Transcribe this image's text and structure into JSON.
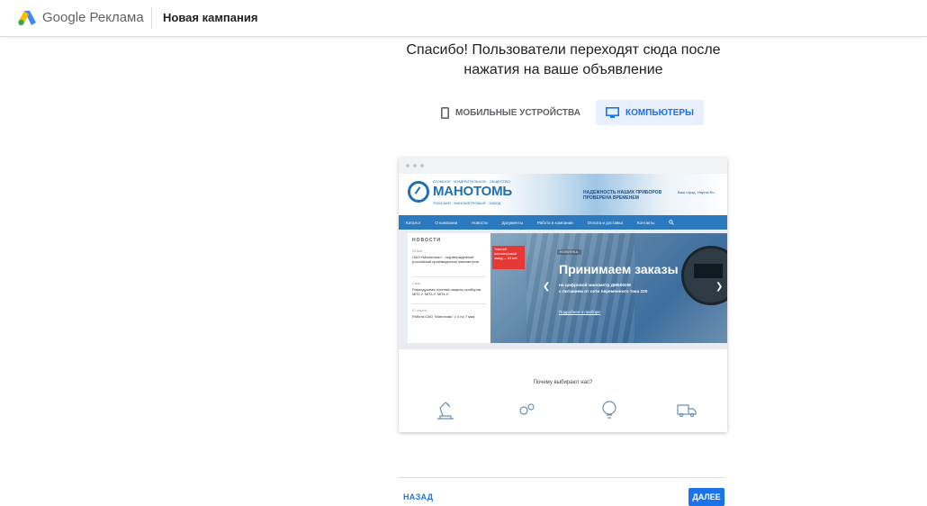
{
  "header": {
    "brand_google": "Google",
    "brand_product": "Реклама",
    "campaign_title": "Новая кампания"
  },
  "main": {
    "heading_line1": "Спасибо! Пользователи переходят сюда после",
    "heading_line2": "нажатия на ваше объявление",
    "device_tabs": [
      {
        "label": "МОБИЛЬНЫЕ УСТРОЙСТВА",
        "selected": false
      },
      {
        "label": "КОМПЬЮТЕРЫ",
        "selected": true
      }
    ]
  },
  "preview": {
    "site_name": "МАНОТОМЬ",
    "site_tagline_top": "АТОМНОЕ · ИЗМЕРИТЕЛЬНОЕ · ОБЩЕСТВО",
    "site_tagline_bottom": "ТОМСКИЙ · МАНОМЕТРОВЫЙ · ЗАВОД",
    "slogan_line1": "НАДЕЖНОСТЬ НАШИХ ПРИБОРОВ",
    "slogan_line2": "ПРОВЕРЕНА ВРЕМЕНЕМ",
    "contact": "Ваш город: Наутек.Ru",
    "nav": [
      "Каталог",
      "О компании",
      "Новости",
      "Документы",
      "Работа в компании",
      "Оплата и доставка",
      "Контакты"
    ],
    "news_heading": "НОВОСТИ",
    "news": [
      {
        "date": "28 мая",
        "text": "ОАО «Манотомь» - подтвержденный российский производитель манометров"
      },
      {
        "date": "4 мая",
        "text": "Равнодушная система защиты приборов МП2-У, МП3-У, МП4-У"
      },
      {
        "date": "22 апреля",
        "text": "Работа ОАО \"Манотомь\" с 4 по 7 мая"
      }
    ],
    "banner_badge": "Томский манометровый завод — 65 лет",
    "banner_tag": "НОВИНКА",
    "banner_title": "Принимаем заказы",
    "banner_sub1": "на цифровой манометр ДМ5002М",
    "banner_sub2": "с питанием от сети переменного тока 220",
    "banner_link": "Подробнее о приборе",
    "why_title": "Почему выбирают нас?"
  },
  "footer": {
    "back_label": "НАЗАД",
    "next_label": "ДАЛЕЕ"
  },
  "colors": {
    "accent": "#1a73e8",
    "selected_tab_bg": "#e8f0fe",
    "site_blue": "#2b79bf"
  }
}
